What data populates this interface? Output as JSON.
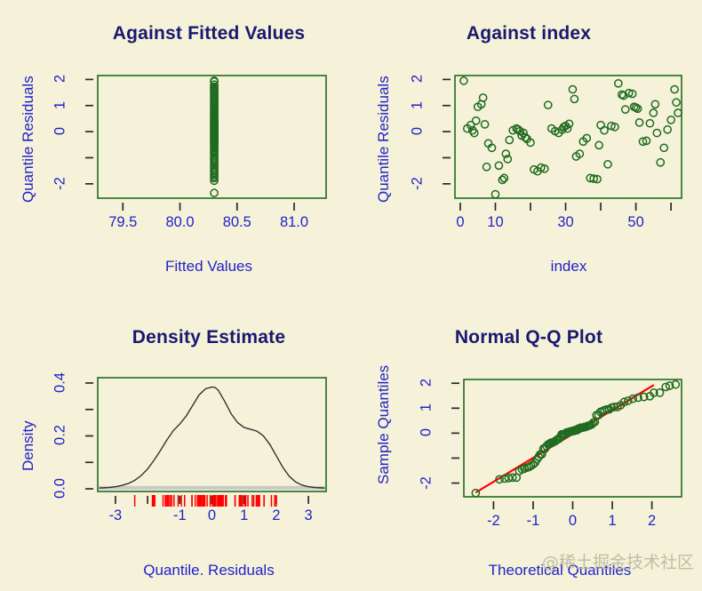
{
  "figure": {
    "background_color": "#f5f2d9",
    "title_color": "#191970",
    "label_color": "#2222cc",
    "box_color": "#1f6b1f",
    "point_color": "#1f6b1f",
    "line_color": "#ff0000",
    "rug_color": "#ff0000",
    "watermark": "@稀土掘金技术社区"
  },
  "chart_data": [
    {
      "type": "scatter",
      "panel": "top-left",
      "title": "Against Fitted Values",
      "xlabel": "Fitted Values",
      "ylabel": "Quantile Residuals",
      "xlim": [
        79.28,
        81.28
      ],
      "ylim": [
        -2.55,
        2.15
      ],
      "xticks": [
        79.5,
        80.0,
        80.5,
        81.0
      ],
      "xticklabels": [
        "79.5",
        "80.0",
        "80.5",
        "81.0"
      ],
      "yticks": [
        -2,
        -1,
        0,
        1,
        2
      ],
      "yticklabels": [
        "-2",
        "",
        "0",
        "1",
        "2"
      ],
      "yticklabels_shown": {
        "-2": "-2",
        "0": "0",
        "1": "1",
        "2": "2"
      },
      "grid": false,
      "legend": "none",
      "x": [
        80.3,
        80.3,
        80.3,
        80.3,
        80.3,
        80.3,
        80.3,
        80.3,
        80.3,
        80.3,
        80.3,
        80.3,
        80.3,
        80.3,
        80.3,
        80.3,
        80.3,
        80.3,
        80.3,
        80.3,
        80.3,
        80.3,
        80.3,
        80.3,
        80.3,
        80.3,
        80.3,
        80.3,
        80.3,
        80.3,
        80.3,
        80.3,
        80.3,
        80.3,
        80.3,
        80.3,
        80.3,
        80.3,
        80.3,
        80.3,
        80.3,
        80.3,
        80.3,
        80.3,
        80.3,
        80.3,
        80.3,
        80.3,
        80.3,
        80.3,
        80.3,
        80.3,
        80.3,
        80.3,
        80.3,
        80.3,
        80.3,
        80.3,
        80.3,
        80.3,
        80.3,
        80.3,
        80.3,
        80.3,
        80.3,
        80.3,
        80.3,
        80.3,
        80.3,
        80.3,
        80.3,
        80.3,
        80.3,
        80.3,
        80.3,
        80.3,
        80.3,
        80.3,
        80.3,
        80.3
      ],
      "y": [
        1.95,
        1.92,
        1.8,
        1.72,
        1.68,
        1.62,
        1.58,
        1.55,
        1.48,
        1.42,
        1.35,
        1.3,
        1.25,
        1.2,
        1.12,
        1.08,
        1.02,
        0.98,
        0.92,
        0.88,
        0.82,
        0.78,
        0.72,
        0.68,
        0.62,
        0.58,
        0.52,
        0.48,
        0.45,
        0.42,
        0.38,
        0.35,
        0.32,
        0.28,
        0.25,
        0.22,
        0.18,
        0.15,
        0.12,
        0.08,
        0.05,
        0.02,
        -0.02,
        -0.05,
        -0.08,
        -0.12,
        -0.15,
        -0.18,
        -0.22,
        -0.25,
        -0.28,
        -0.32,
        -0.35,
        -0.38,
        -0.42,
        -0.45,
        -0.48,
        -0.52,
        -0.58,
        -0.62,
        -0.68,
        -0.72,
        -0.78,
        -0.82,
        -0.88,
        -0.95,
        -1.02,
        -1.08,
        -1.15,
        -1.22,
        -1.3,
        -1.38,
        -1.45,
        -1.52,
        -1.58,
        -1.65,
        -1.72,
        -1.78,
        -1.88,
        -2.35
      ]
    },
    {
      "type": "scatter",
      "panel": "top-right",
      "title": "Against  index",
      "xlabel": "index",
      "ylabel": "Quantile Residuals",
      "xlim": [
        -1.5,
        63.0
      ],
      "ylim": [
        -2.55,
        2.15
      ],
      "xticks": [
        0,
        10,
        20,
        30,
        40,
        50,
        60
      ],
      "xticklabels_shown": {
        "0": "0",
        "10": "10",
        "30": "30",
        "50": "50"
      },
      "yticks": [
        -2,
        -1,
        0,
        1,
        2
      ],
      "yticklabels_shown": {
        "-2": "-2",
        "0": "0",
        "1": "1",
        "2": "2"
      },
      "grid": false,
      "legend": "none",
      "x": [
        1,
        2,
        3,
        3.5,
        4,
        4.5,
        5,
        6,
        6.5,
        7,
        7.5,
        8,
        9,
        10,
        11,
        12,
        12.5,
        13,
        13.5,
        14,
        15,
        16,
        16.5,
        17,
        17.5,
        18,
        18.5,
        19,
        20,
        21,
        22,
        23,
        24,
        25,
        26,
        27,
        28,
        29,
        29.5,
        30,
        30.5,
        31,
        32,
        32.5,
        33,
        34,
        35,
        36,
        37,
        38,
        39,
        39.5,
        40,
        41,
        42,
        43,
        44,
        45,
        46,
        46.5,
        47,
        48,
        49,
        49.5,
        50,
        50.5,
        51,
        52,
        53,
        54,
        55,
        55.5,
        56,
        57,
        58,
        59,
        60,
        61,
        61.5,
        62
      ],
      "y": [
        1.95,
        0.12,
        0.25,
        0.05,
        -0.05,
        0.42,
        0.95,
        1.05,
        1.3,
        0.28,
        -1.35,
        -0.45,
        -0.62,
        -2.4,
        -1.3,
        -1.85,
        -1.78,
        -0.85,
        -1.05,
        -0.32,
        0.05,
        0.12,
        0.08,
        0.02,
        -0.15,
        -0.05,
        -0.22,
        -0.28,
        -0.42,
        -1.45,
        -1.52,
        -1.38,
        -1.42,
        1.02,
        0.12,
        0.02,
        -0.05,
        0.08,
        0.18,
        0.22,
        0.12,
        0.3,
        1.62,
        1.25,
        -0.95,
        -0.85,
        -0.38,
        -0.25,
        -1.78,
        -1.8,
        -1.82,
        -0.52,
        0.25,
        0.05,
        -1.25,
        0.22,
        0.18,
        1.85,
        1.42,
        1.38,
        0.85,
        1.48,
        1.45,
        0.95,
        0.92,
        0.88,
        0.35,
        -0.38,
        -0.35,
        0.32,
        0.72,
        1.05,
        -0.05,
        -1.18,
        -0.62,
        0.08,
        0.45,
        1.62,
        1.12,
        0.72
      ]
    },
    {
      "type": "line",
      "panel": "bottom-left",
      "title": "Density Estimate",
      "xlabel": "Quantile. Residuals",
      "ylabel": "Density",
      "xlim": [
        -3.55,
        3.55
      ],
      "ylim": [
        -0.01,
        0.42
      ],
      "xticks": [
        -3,
        -2,
        -1,
        0,
        1,
        2,
        3
      ],
      "xticklabels_shown": {
        "-3": "-3",
        "-1": "-1",
        "0": "0",
        "1": "1",
        "2": "2",
        "3": "3"
      },
      "yticks": [
        0.0,
        0.1,
        0.2,
        0.3,
        0.4
      ],
      "yticklabels_shown": {
        "0.0": "0.0",
        "0.2": "0.2",
        "0.4": "0.4"
      },
      "grid": false,
      "legend": "none",
      "curve_x": [
        -3.5,
        -3.2,
        -3.0,
        -2.8,
        -2.6,
        -2.4,
        -2.2,
        -2.0,
        -1.8,
        -1.6,
        -1.4,
        -1.2,
        -1.0,
        -0.8,
        -0.6,
        -0.4,
        -0.2,
        0.0,
        0.1,
        0.2,
        0.4,
        0.6,
        0.8,
        1.0,
        1.2,
        1.4,
        1.6,
        1.8,
        2.0,
        2.2,
        2.4,
        2.6,
        2.8,
        3.0,
        3.2,
        3.5
      ],
      "curve_y": [
        0.003,
        0.005,
        0.008,
        0.013,
        0.02,
        0.032,
        0.05,
        0.075,
        0.108,
        0.145,
        0.185,
        0.22,
        0.245,
        0.275,
        0.315,
        0.355,
        0.378,
        0.385,
        0.383,
        0.372,
        0.33,
        0.283,
        0.25,
        0.232,
        0.225,
        0.218,
        0.2,
        0.168,
        0.125,
        0.082,
        0.048,
        0.026,
        0.014,
        0.008,
        0.005,
        0.003
      ],
      "rug_values": [
        -2.4,
        -1.85,
        -1.82,
        -1.8,
        -1.78,
        -1.78,
        -1.52,
        -1.45,
        -1.42,
        -1.38,
        -1.35,
        -1.3,
        -1.25,
        -1.18,
        -1.05,
        -0.95,
        -0.85,
        -0.85,
        -0.62,
        -0.62,
        -0.52,
        -0.45,
        -0.42,
        -0.38,
        -0.38,
        -0.35,
        -0.32,
        -0.28,
        -0.25,
        -0.22,
        -0.15,
        -0.05,
        -0.05,
        -0.05,
        -0.05,
        0.02,
        0.02,
        0.05,
        0.05,
        0.08,
        0.08,
        0.08,
        0.12,
        0.12,
        0.12,
        0.18,
        0.18,
        0.22,
        0.22,
        0.22,
        0.25,
        0.25,
        0.28,
        0.3,
        0.32,
        0.35,
        0.42,
        0.45,
        0.72,
        0.72,
        0.85,
        0.88,
        0.92,
        0.95,
        0.95,
        1.02,
        1.05,
        1.05,
        1.12,
        1.25,
        1.3,
        1.38,
        1.42,
        1.45,
        1.48,
        1.62,
        1.62,
        1.85,
        1.95,
        2.0
      ]
    },
    {
      "type": "scatter",
      "panel": "bottom-right",
      "title": "Normal Q-Q Plot",
      "xlabel": "Theoretical Quantiles",
      "ylabel": "Sample Quantiles",
      "xlim": [
        -2.75,
        2.75
      ],
      "ylim": [
        -2.55,
        2.15
      ],
      "xticks": [
        -2,
        -1,
        0,
        1,
        2
      ],
      "xticklabels": [
        "-2",
        "-1",
        "0",
        "1",
        "2"
      ],
      "yticks": [
        -2,
        -1,
        0,
        1,
        2
      ],
      "yticklabels_shown": {
        "-2": "-2",
        "0": "0",
        "1": "1",
        "2": "2"
      },
      "grid": false,
      "legend": "none",
      "reference_line": {
        "x": [
          -2.45,
          2.05
        ],
        "y": [
          -2.38,
          1.93
        ]
      },
      "x": [
        -2.45,
        -1.85,
        -1.72,
        -1.62,
        -1.52,
        -1.42,
        -1.35,
        -1.28,
        -1.22,
        -1.15,
        -1.1,
        -1.05,
        -1.0,
        -0.95,
        -0.9,
        -0.86,
        -0.82,
        -0.78,
        -0.74,
        -0.7,
        -0.66,
        -0.62,
        -0.58,
        -0.55,
        -0.51,
        -0.48,
        -0.44,
        -0.41,
        -0.38,
        -0.34,
        -0.31,
        -0.28,
        -0.25,
        -0.22,
        -0.19,
        -0.16,
        -0.13,
        -0.1,
        -0.07,
        -0.04,
        -0.01,
        0.02,
        0.05,
        0.08,
        0.11,
        0.14,
        0.17,
        0.2,
        0.23,
        0.26,
        0.3,
        0.33,
        0.37,
        0.4,
        0.44,
        0.48,
        0.52,
        0.56,
        0.6,
        0.65,
        0.7,
        0.75,
        0.8,
        0.86,
        0.92,
        0.98,
        1.05,
        1.13,
        1.21,
        1.3,
        1.4,
        1.52,
        1.65,
        1.8,
        1.95,
        2.05,
        2.2,
        2.35,
        2.45,
        2.6
      ],
      "y": [
        -2.4,
        -1.85,
        -1.82,
        -1.8,
        -1.78,
        -1.78,
        -1.52,
        -1.45,
        -1.42,
        -1.38,
        -1.35,
        -1.3,
        -1.25,
        -1.18,
        -1.05,
        -0.95,
        -0.85,
        -0.85,
        -0.62,
        -0.62,
        -0.52,
        -0.45,
        -0.42,
        -0.38,
        -0.38,
        -0.35,
        -0.32,
        -0.28,
        -0.25,
        -0.22,
        -0.15,
        -0.05,
        -0.05,
        -0.05,
        -0.05,
        0.02,
        0.02,
        0.05,
        0.05,
        0.08,
        0.08,
        0.08,
        0.12,
        0.12,
        0.12,
        0.18,
        0.18,
        0.22,
        0.22,
        0.22,
        0.25,
        0.25,
        0.28,
        0.3,
        0.32,
        0.35,
        0.42,
        0.45,
        0.72,
        0.72,
        0.85,
        0.88,
        0.92,
        0.95,
        0.95,
        1.02,
        1.05,
        1.05,
        1.12,
        1.25,
        1.3,
        1.38,
        1.42,
        1.45,
        1.48,
        1.62,
        1.62,
        1.85,
        1.9,
        1.95
      ]
    }
  ]
}
